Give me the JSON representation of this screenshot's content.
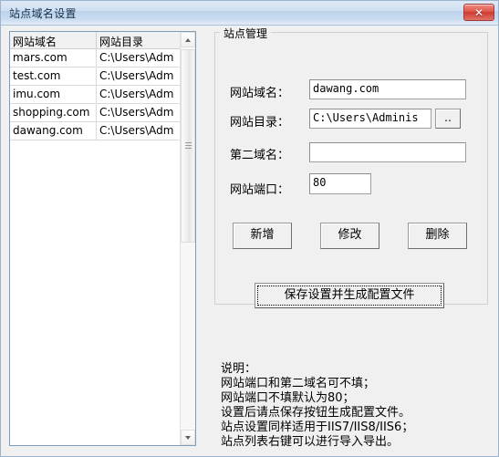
{
  "window": {
    "title": "站点域名设置",
    "close_label": "✕",
    "accent_title_color": "#15314f",
    "close_button_color": "#cd3b32"
  },
  "listview": {
    "columns": [
      "网站域名",
      "网站目录"
    ],
    "rows": [
      {
        "domain": "mars.com",
        "dir": "C:\\Users\\Adm"
      },
      {
        "domain": "test.com",
        "dir": "C:\\Users\\Adm"
      },
      {
        "domain": "imu.com",
        "dir": "C:\\Users\\Adm"
      },
      {
        "domain": "shopping.com",
        "dir": "C:\\Users\\Adm"
      },
      {
        "domain": "dawang.com",
        "dir": "C:\\Users\\Adm"
      }
    ],
    "scrollbar": {
      "up_arrow": "▲",
      "down_arrow": "▼"
    }
  },
  "groupbox": {
    "title": "站点管理",
    "fields": [
      {
        "label": "网站域名：",
        "value": "dawang.com",
        "placeholder": ""
      },
      {
        "label": "网站目录：",
        "value": "C:\\Users\\Adminis",
        "placeholder": ""
      },
      {
        "label": "第二域名：",
        "value": "",
        "placeholder": ""
      },
      {
        "label": "网站端口：",
        "value": "80",
        "placeholder": ""
      }
    ],
    "browse_label": "‥",
    "buttons": {
      "add": "新增",
      "edit": "修改",
      "delete": "删除",
      "save": "保存设置并生成配置文件"
    }
  },
  "help": {
    "text": "说明：\n网站端口和第二域名可不填；\n网站端口不填默认为80；\n设置后请点保存按钮生成配置文件。\n站点设置同样适用于IIS7/IIS8/IIS6；\n站点列表右键可以进行导入导出。"
  }
}
